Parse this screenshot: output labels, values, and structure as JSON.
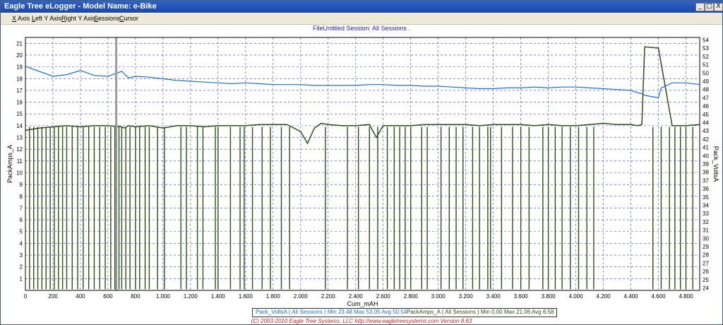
{
  "window": {
    "title": "Eagle Tree eLogger - Model Name: e-Bike",
    "controls": {
      "minimize": "_",
      "restore": "□",
      "close": "X"
    }
  },
  "menu": {
    "items": [
      {
        "label": "X Axis",
        "underline": "X",
        "rest": " Axis"
      },
      {
        "label": "Left Y Axis",
        "underline": "L",
        "rest": "eft Y Axis"
      },
      {
        "label": "Right Y Axis",
        "underline": "R",
        "rest": "ight Y Axis"
      },
      {
        "label": "Sessions",
        "underline": "S",
        "rest": "essions"
      },
      {
        "label": "Cursor",
        "underline": "C",
        "rest": "ursor"
      }
    ]
  },
  "header": {
    "text": "FileUntitled   Session: All Sessions ."
  },
  "chart_data": {
    "type": "line",
    "xlabel": "Cum_mAH",
    "ylabel_left": "PackAmps_A",
    "ylabel_right": "Pack_VoltsA",
    "xlim": [
      0,
      4900
    ],
    "ylim_left": [
      0,
      21.5
    ],
    "ylim_right": [
      23.7,
      54.3
    ],
    "x_ticks": [
      "0",
      "200",
      "400",
      "600",
      "800",
      "1.000",
      "1.200",
      "1.400",
      "1.600",
      "1.800",
      "2.000",
      "2.200",
      "2.400",
      "2.600",
      "2.800",
      "3.000",
      "3.200",
      "3.400",
      "3.600",
      "3.800",
      "4.000",
      "4.200",
      "4.400",
      "4.600",
      "4.800"
    ],
    "x_tick_values": [
      0,
      200,
      400,
      600,
      800,
      1000,
      1200,
      1400,
      1600,
      1800,
      2000,
      2200,
      2400,
      2600,
      2800,
      3000,
      3200,
      3400,
      3600,
      3800,
      4000,
      4200,
      4400,
      4600,
      4800
    ],
    "y_left_ticks": [
      1,
      2,
      3,
      4,
      5,
      6,
      7,
      8,
      9,
      10,
      11,
      12,
      13,
      14,
      15,
      16,
      17,
      18,
      19,
      20,
      21
    ],
    "y_right_ticks": [
      24,
      25,
      26,
      27,
      28,
      29,
      30,
      31,
      32,
      33,
      34,
      35,
      36,
      37,
      38,
      39,
      40,
      41,
      42,
      43,
      44,
      45,
      46,
      47,
      48,
      49,
      50,
      51,
      52,
      53,
      54
    ],
    "grid": true,
    "cursor_x": 660,
    "series": [
      {
        "name": "Pack_VoltsA",
        "axis": "right",
        "color": "#1e6ed8",
        "x": [
          0,
          100,
          200,
          300,
          400,
          500,
          600,
          700,
          750,
          800,
          900,
          1000,
          1100,
          1200,
          1300,
          1400,
          1500,
          1600,
          1700,
          1800,
          1900,
          2000,
          2100,
          2200,
          2300,
          2400,
          2500,
          2600,
          2700,
          2800,
          2900,
          3000,
          3100,
          3200,
          3300,
          3400,
          3500,
          3600,
          3700,
          3800,
          3900,
          4000,
          4100,
          4200,
          4300,
          4400,
          4450,
          4480,
          4500,
          4600,
          4620,
          4700,
          4800,
          4900
        ],
        "y": [
          50.8,
          50.2,
          49.6,
          49.8,
          50.3,
          49.7,
          49.6,
          50.2,
          49.4,
          49.6,
          49.5,
          49.3,
          49.1,
          49.0,
          48.9,
          48.8,
          48.7,
          48.8,
          48.7,
          48.6,
          48.6,
          48.6,
          48.5,
          48.5,
          48.5,
          48.5,
          48.6,
          48.6,
          48.5,
          48.5,
          48.4,
          48.4,
          48.3,
          48.2,
          48.1,
          48.1,
          48.2,
          48.2,
          48.3,
          48.2,
          48.3,
          48.3,
          48.2,
          48.1,
          48.0,
          47.9,
          47.6,
          47.5,
          47.3,
          47.0,
          48.2,
          48.8,
          48.8,
          48.6
        ]
      },
      {
        "name": "PackAmps_A",
        "axis": "left",
        "color": "#2d5014",
        "x": [
          0,
          100,
          200,
          300,
          400,
          500,
          600,
          700,
          720,
          750,
          800,
          900,
          1000,
          1100,
          1200,
          1300,
          1400,
          1500,
          1600,
          1700,
          1800,
          1900,
          2000,
          2050,
          2100,
          2150,
          2200,
          2300,
          2400,
          2500,
          2550,
          2600,
          2700,
          2800,
          2900,
          3000,
          3100,
          3200,
          3300,
          3400,
          3500,
          3600,
          3700,
          3800,
          3900,
          4000,
          4100,
          4200,
          4300,
          4400,
          4450,
          4480,
          4500,
          4600,
          4700,
          4800,
          4900
        ],
        "y": [
          13.6,
          13.8,
          13.9,
          14.0,
          13.9,
          14.0,
          14.0,
          13.9,
          13.8,
          14.0,
          13.9,
          14.0,
          13.8,
          14.0,
          14.0,
          13.9,
          14.0,
          14.0,
          14.0,
          14.1,
          14.1,
          14.1,
          13.5,
          12.5,
          13.8,
          14.2,
          14.1,
          14.0,
          14.0,
          14.1,
          13.0,
          14.0,
          14.0,
          14.0,
          14.1,
          14.1,
          14.1,
          14.1,
          14.0,
          14.1,
          14.1,
          14.1,
          14.0,
          14.1,
          14.0,
          14.0,
          14.1,
          14.2,
          14.1,
          14.1,
          14.0,
          14.1,
          20.7,
          20.6,
          14.0,
          14.0,
          14.1
        ]
      }
    ],
    "dropouts_amps": [
      30,
      60,
      90,
      120,
      150,
      180,
      210,
      240,
      270,
      300,
      340,
      380,
      420,
      460,
      500,
      540,
      580,
      620,
      650,
      680,
      700,
      730,
      760,
      800,
      830,
      870,
      900,
      960,
      1010,
      1130,
      1170,
      1250,
      1290,
      1380,
      1400,
      1490,
      1560,
      1590,
      1650,
      1720,
      1780,
      1860,
      1920,
      2180,
      2340,
      2420,
      2500,
      2560,
      2630,
      2680,
      2720,
      2760,
      2800,
      2880,
      2920,
      3020,
      3080,
      3130,
      3180,
      3250,
      3300,
      3360,
      3380,
      3460,
      3540,
      3600,
      3660,
      3760,
      3800,
      3850,
      3900,
      3960,
      4020,
      4080,
      4130,
      4560,
      4620,
      4680,
      4720,
      4760,
      4800,
      4850
    ]
  },
  "footer": {
    "volts_legend": "Pack_VoltsA  ( All Sessions )   Min 23.48   Max 53.05   Avg 50.54",
    "amps_legend": "PackAmps_A  ( All Sessions )   Min 0.00   Max 21.06   Avg 6.58",
    "copyright": "(C) 2003-2010 Eagle Tree Systems, LLC      http://www.eagletreesystems.com     Version 8.63"
  }
}
